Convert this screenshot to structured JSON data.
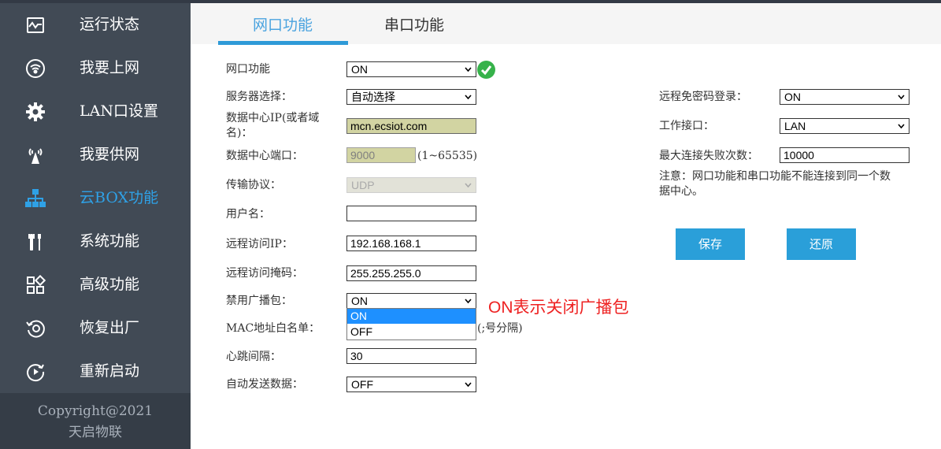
{
  "sidebar": {
    "items": [
      {
        "label": "运行状态",
        "icon": "monitor-chart-icon"
      },
      {
        "label": "我要上网",
        "icon": "wifi-icon"
      },
      {
        "label": "LAN口设置",
        "icon": "gear-icon"
      },
      {
        "label": "我要供网",
        "icon": "broadcast-tower-icon"
      },
      {
        "label": "云BOX功能",
        "icon": "network-tree-icon"
      },
      {
        "label": "系统功能",
        "icon": "tools-icon"
      },
      {
        "label": "高级功能",
        "icon": "grid-icon"
      },
      {
        "label": "恢复出厂",
        "icon": "restore-icon"
      },
      {
        "label": "重新启动",
        "icon": "restart-icon"
      }
    ],
    "active_index": 4,
    "footer_line1": "Copyright@2021",
    "footer_line2": "天启物联"
  },
  "tabs": [
    {
      "label": "网口功能",
      "active": true
    },
    {
      "label": "串口功能",
      "active": false
    }
  ],
  "form": {
    "net_func": {
      "label": "网口功能",
      "value": "ON"
    },
    "server_select": {
      "label": "服务器选择：",
      "value": "自动选择"
    },
    "dc_ip": {
      "label_line1": "数据中心IP(或者域",
      "label_line2": "名)：",
      "value": "mcn.ecsiot.com"
    },
    "dc_port": {
      "label": "数据中心端口：",
      "value": "9000",
      "hint": "(1~65535)"
    },
    "protocol": {
      "label": "传输协议：",
      "value": "UDP"
    },
    "username": {
      "label": "用户名：",
      "value": ""
    },
    "remote_ip": {
      "label": "远程访问IP：",
      "value": "192.168.168.1"
    },
    "remote_mask": {
      "label": "远程访问掩码：",
      "value": "255.255.255.0"
    },
    "disable_broadcast": {
      "label": "禁用广播包：",
      "value": "ON",
      "options": [
        "ON",
        "OFF"
      ],
      "highlighted": "ON"
    },
    "mac_whitelist": {
      "label": "MAC地址白名单：",
      "hint": "(;号分隔)"
    },
    "heartbeat": {
      "label": "心跳间隔：",
      "value": "30"
    },
    "auto_send": {
      "label": "自动发送数据：",
      "value": "OFF"
    }
  },
  "right": {
    "pwfree_login": {
      "label": "远程免密码登录：",
      "value": "ON"
    },
    "work_iface": {
      "label": "工作接口：",
      "value": "LAN"
    },
    "max_fail": {
      "label": "最大连接失败次数：",
      "value": "10000"
    },
    "note_line1": "注意：网口功能和串口功能不能连接到同一个数",
    "note_line2": "据中心。"
  },
  "buttons": {
    "save": "保存",
    "restore": "还原"
  },
  "annotation": "ON表示关闭广播包",
  "colors": {
    "sidebar_bg": "#414a55",
    "sidebar_active": "#2fa1e6",
    "accent": "#2a9fd9",
    "annotation": "#ee2222",
    "check": "#36b24a"
  }
}
